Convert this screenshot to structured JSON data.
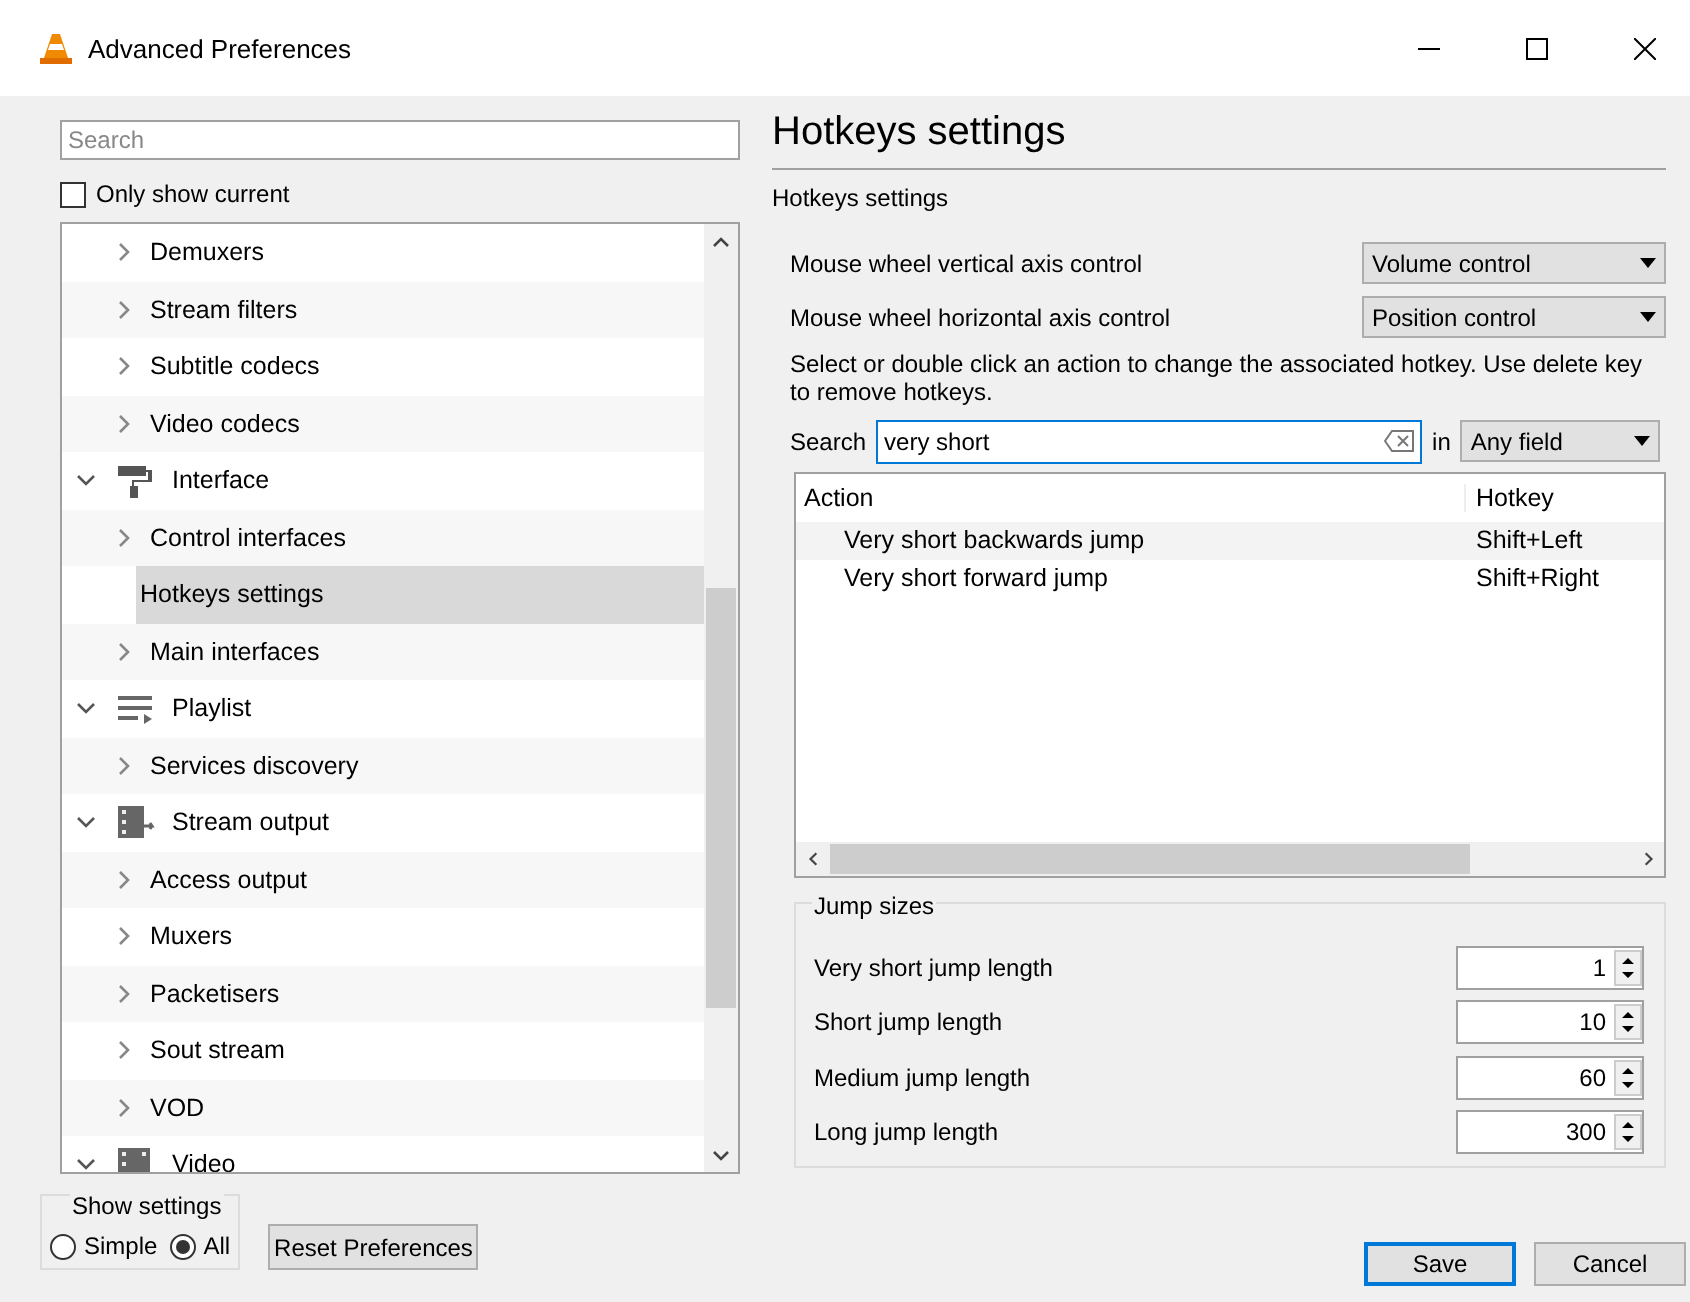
{
  "window": {
    "title": "Advanced Preferences"
  },
  "sidebar": {
    "search": {
      "placeholder": "Search"
    },
    "only_show_current": {
      "label": "Only show current",
      "checked": false
    },
    "tree": {
      "items_of_hidden_parent": [
        {
          "label": "Demuxers",
          "expanded": false,
          "selected": false
        },
        {
          "label": "Stream filters",
          "expanded": false,
          "selected": false
        },
        {
          "label": "Subtitle codecs",
          "expanded": false,
          "selected": false
        },
        {
          "label": "Video codecs",
          "expanded": false,
          "selected": false
        }
      ],
      "items": [
        {
          "label": "Interface",
          "kind": "interface",
          "expanded": true,
          "selected": false,
          "children": [
            {
              "label": "Control interfaces",
              "expanded": false,
              "selected": false
            },
            {
              "label": "Hotkeys settings",
              "selected": true
            },
            {
              "label": "Main interfaces",
              "expanded": false,
              "selected": false
            }
          ]
        },
        {
          "label": "Playlist",
          "kind": "playlist",
          "expanded": true,
          "selected": false,
          "children": [
            {
              "label": "Services discovery",
              "expanded": false,
              "selected": false
            }
          ]
        },
        {
          "label": "Stream output",
          "kind": "stream",
          "expanded": true,
          "selected": false,
          "children": [
            {
              "label": "Access output",
              "expanded": false,
              "selected": false
            },
            {
              "label": "Muxers",
              "expanded": false,
              "selected": false
            },
            {
              "label": "Packetisers",
              "expanded": false,
              "selected": false
            },
            {
              "label": "Sout stream",
              "expanded": false,
              "selected": false
            },
            {
              "label": "VOD",
              "expanded": false,
              "selected": false
            }
          ]
        },
        {
          "label": "Video",
          "kind": "video",
          "expanded": true,
          "selected": false
        }
      ]
    },
    "show_settings": {
      "title": "Show settings",
      "options": [
        {
          "label": "Simple",
          "selected": false
        },
        {
          "label": "All",
          "selected": true
        }
      ]
    },
    "reset_button": "Reset Preferences"
  },
  "panel": {
    "heading": "Hotkeys settings",
    "subheading": "Hotkeys settings",
    "dropdowns": [
      {
        "label": "Mouse wheel vertical axis control",
        "value": "Volume control"
      },
      {
        "label": "Mouse wheel horizontal axis control",
        "value": "Position control"
      }
    ],
    "hint": "Select or double click an action to change the associated hotkey. Use delete key to remove hotkeys.",
    "search": {
      "label": "Search",
      "value": "very short",
      "in_label": "in",
      "scope": "Any field"
    },
    "table": {
      "columns": [
        "Action",
        "Hotkey"
      ],
      "rows": [
        {
          "action": "Very short backwards jump",
          "hotkey": "Shift+Left"
        },
        {
          "action": "Very short forward jump",
          "hotkey": "Shift+Right"
        }
      ]
    },
    "jump_sizes": {
      "title": "Jump sizes",
      "fields": [
        {
          "label": "Very short jump length",
          "value": "1"
        },
        {
          "label": "Short jump length",
          "value": "10"
        },
        {
          "label": "Medium jump length",
          "value": "60"
        },
        {
          "label": "Long jump length",
          "value": "300"
        }
      ]
    }
  },
  "buttons": [
    {
      "label": "Save",
      "kind": "default"
    },
    {
      "label": "Cancel",
      "kind": "normal"
    }
  ]
}
